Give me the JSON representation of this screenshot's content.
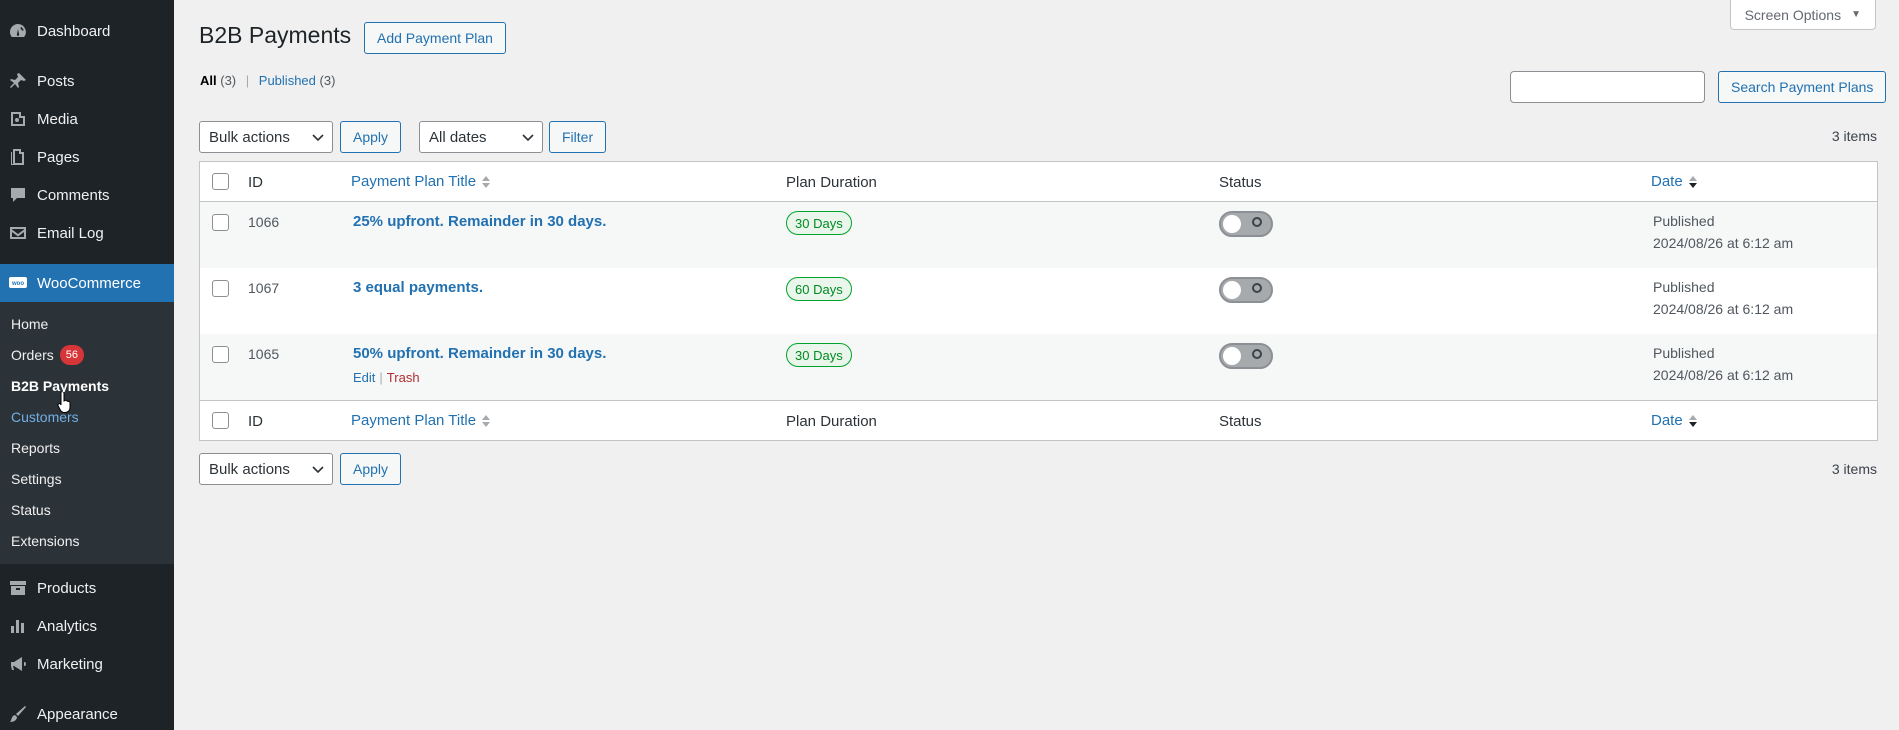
{
  "sidebar": {
    "top_items": [
      {
        "label": "Dashboard",
        "icon": "dashboard-icon"
      },
      {
        "label": "Posts",
        "icon": "pin-icon"
      },
      {
        "label": "Media",
        "icon": "media-icon"
      },
      {
        "label": "Pages",
        "icon": "pages-icon"
      },
      {
        "label": "Comments",
        "icon": "comment-icon"
      },
      {
        "label": "Email Log",
        "icon": "email-icon"
      }
    ],
    "woocommerce": {
      "label": "WooCommerce",
      "icon": "woo-icon"
    },
    "sub_items": [
      {
        "label": "Home"
      },
      {
        "label": "Orders",
        "badge": "56"
      },
      {
        "label": "B2B Payments"
      },
      {
        "label": "Customers"
      },
      {
        "label": "Reports"
      },
      {
        "label": "Settings"
      },
      {
        "label": "Status"
      },
      {
        "label": "Extensions"
      }
    ],
    "bottom_items": [
      {
        "label": "Products",
        "icon": "archive-icon"
      },
      {
        "label": "Analytics",
        "icon": "bar-chart-icon"
      },
      {
        "label": "Marketing",
        "icon": "megaphone-icon"
      },
      {
        "label": "Appearance",
        "icon": "paintbrush-icon"
      }
    ]
  },
  "header": {
    "title": "B2B Payments",
    "add_button": "Add Payment Plan",
    "screen_options": "Screen Options"
  },
  "filters": {
    "all_label": "All",
    "all_count": "(3)",
    "published_label": "Published",
    "published_count": "(3)"
  },
  "search": {
    "button": "Search Payment Plans",
    "value": ""
  },
  "tablenav": {
    "bulk_actions": "Bulk actions",
    "apply": "Apply",
    "all_dates": "All dates",
    "filter": "Filter",
    "items_count": "3 items"
  },
  "table": {
    "columns": {
      "id": "ID",
      "title": "Payment Plan Title",
      "duration": "Plan Duration",
      "status": "Status",
      "date": "Date"
    },
    "rows": [
      {
        "id": "1066",
        "title": "25% upfront. Remainder in 30 days.",
        "duration": "30 Days",
        "status_label": "Published",
        "date": "2024/08/26 at 6:12 am"
      },
      {
        "id": "1067",
        "title": "3 equal payments.",
        "duration": "60 Days",
        "status_label": "Published",
        "date": "2024/08/26 at 6:12 am"
      },
      {
        "id": "1065",
        "title": "50% upfront. Remainder in 30 days.",
        "duration": "30 Days",
        "status_label": "Published",
        "date": "2024/08/26 at 6:12 am",
        "actions": {
          "edit": "Edit",
          "trash": "Trash"
        }
      }
    ]
  },
  "colors": {
    "sidebar_bg": "#1d2327",
    "accent": "#2271b1",
    "badge": "#d63638",
    "pill_green": "#00a32a",
    "trash": "#b32d2e"
  }
}
